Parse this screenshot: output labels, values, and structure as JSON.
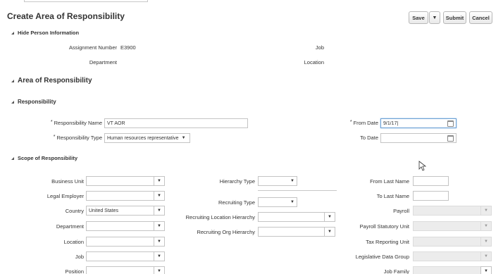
{
  "title": "Create Area of Responsibility",
  "buttons": {
    "save": "Save",
    "save_menu": "▼",
    "submit": "Submit",
    "cancel": "Cancel"
  },
  "person_section": {
    "header": "Hide Person Information",
    "assignment_number_label": "Assignment Number",
    "assignment_number_value": "E3900",
    "job_label": "Job",
    "department_label": "Department",
    "location_label": "Location"
  },
  "aor_header": "Area of Responsibility",
  "responsibility": {
    "header": "Responsibility",
    "name_label": "Responsibility Name",
    "name_value": "VT AOR",
    "type_label": "Responsibility Type",
    "type_value": "Human resources representative",
    "from_date_label": "From Date",
    "from_date_value": "9/1/17|",
    "to_date_label": "To Date",
    "to_date_value": ""
  },
  "scope": {
    "header": "Scope of Responsibility",
    "left": [
      {
        "label": "Business Unit",
        "value": ""
      },
      {
        "label": "Legal Employer",
        "value": ""
      },
      {
        "label": "Country",
        "value": "United States"
      },
      {
        "label": "Department",
        "value": ""
      },
      {
        "label": "Location",
        "value": ""
      },
      {
        "label": "Job",
        "value": ""
      },
      {
        "label": "Position",
        "value": ""
      }
    ],
    "middle": {
      "hierarchy_type_label": "Hierarchy Type",
      "recruiting_type_label": "Recruiting Type",
      "recruiting_location_label": "Recruiting Location Hierarchy",
      "recruiting_org_label": "Recruiting Org Hierarchy"
    },
    "right": {
      "from_last_name_label": "From Last Name",
      "to_last_name_label": "To Last Name",
      "payroll_label": "Payroll",
      "payroll_statutory_label": "Payroll Statutory Unit",
      "tax_reporting_label": "Tax Reporting Unit",
      "legislative_label": "Legislative Data Group",
      "job_family_label": "Job Family"
    }
  },
  "symbols": {
    "required": "*",
    "dropdown": "▼"
  }
}
